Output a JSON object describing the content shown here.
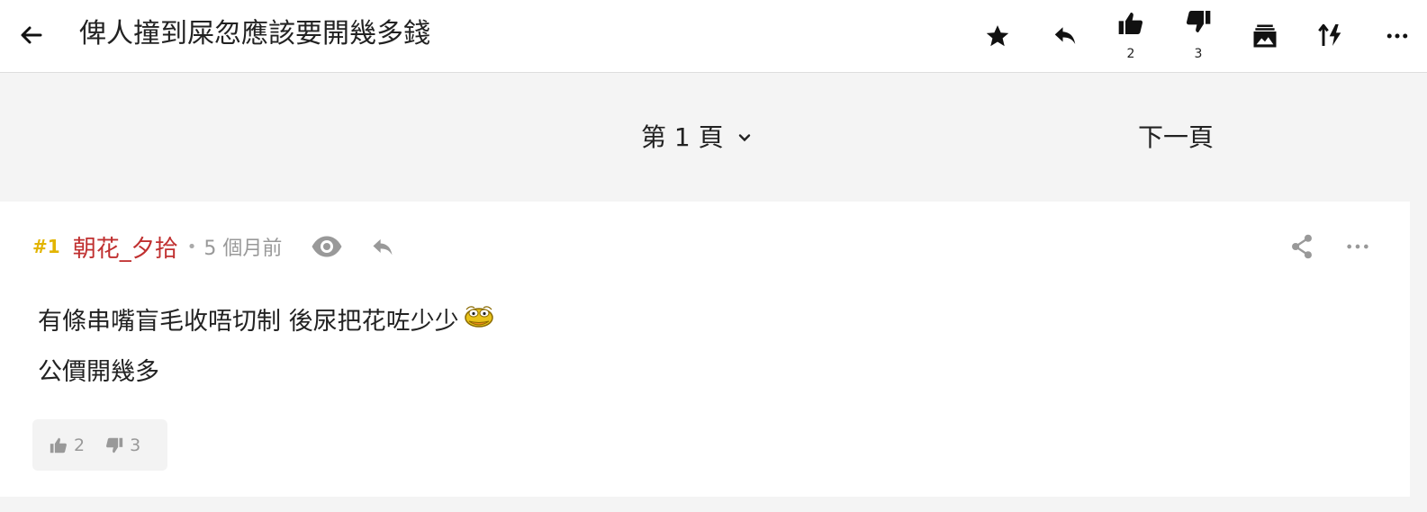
{
  "topbar": {
    "title": "俾人撞到屎忽應該要開幾多錢",
    "icons": [
      "arrow-left-icon",
      "star-icon",
      "reply-icon",
      "thumbs-up-icon",
      "thumbs-down-icon",
      "image-gallery-icon",
      "sort-icon",
      "more-icon"
    ],
    "like_count": "2",
    "dislike_count": "3"
  },
  "pager": {
    "page_label": "第 1 頁",
    "next_label": "下一頁"
  },
  "post": {
    "floor": "#1",
    "username": "朝花_夕拾",
    "dot": "•",
    "time": "5 個月前",
    "body_line1": "有條串嘴盲毛收唔切制 後尿把花咗少少",
    "body_line2": "公價開幾多",
    "emoji": "duck-emoji",
    "like_count": "2",
    "dislike_count": "3"
  },
  "colors": {
    "floor": "#e2b400",
    "username": "#c03030",
    "muted": "#999999"
  }
}
